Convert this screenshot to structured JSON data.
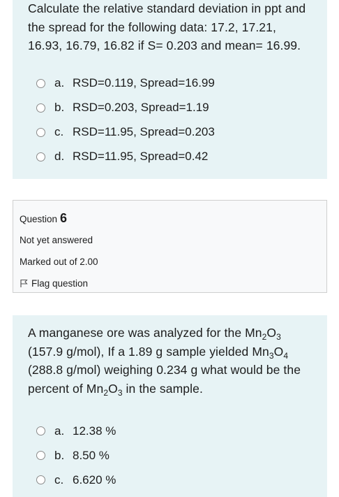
{
  "question5": {
    "text": "Calculate the relative standard deviation in ppt and the spread for the following data: 17.2, 17.21, 16.93, 16.79, 16.82 if S= 0.203 and mean= 16.99.",
    "options": [
      {
        "letter": "a.",
        "text": "RSD=0.119, Spread=16.99"
      },
      {
        "letter": "b.",
        "text": "RSD=0.203, Spread=1.19"
      },
      {
        "letter": "c.",
        "text": "RSD=11.95, Spread=0.203"
      },
      {
        "letter": "d.",
        "text": "RSD=11.95, Spread=0.42"
      }
    ]
  },
  "question6": {
    "label": "Question",
    "number": "6",
    "status": "Not yet answered",
    "marks": "Marked out of 2.00",
    "flag_label": "Flag question",
    "text_parts": {
      "p1": "A manganese ore was analyzed for the Mn",
      "sub1a": "2",
      "p2": "O",
      "sub1b": "3",
      "p3": " (157.9 g/mol), If a 1.89 g sample yielded Mn",
      "sub2a": "3",
      "p4": "O",
      "sub2b": "4",
      "p5": " (288.8 g/mol) weighing 0.234 g what would be the percent of Mn",
      "sub3a": "2",
      "p6": "O",
      "sub3b": "3",
      "p7": " in the sample."
    },
    "options": [
      {
        "letter": "a.",
        "text": "12.38 %"
      },
      {
        "letter": "b.",
        "text": "8.50 %"
      },
      {
        "letter": "c.",
        "text": "6.620 %"
      }
    ]
  }
}
